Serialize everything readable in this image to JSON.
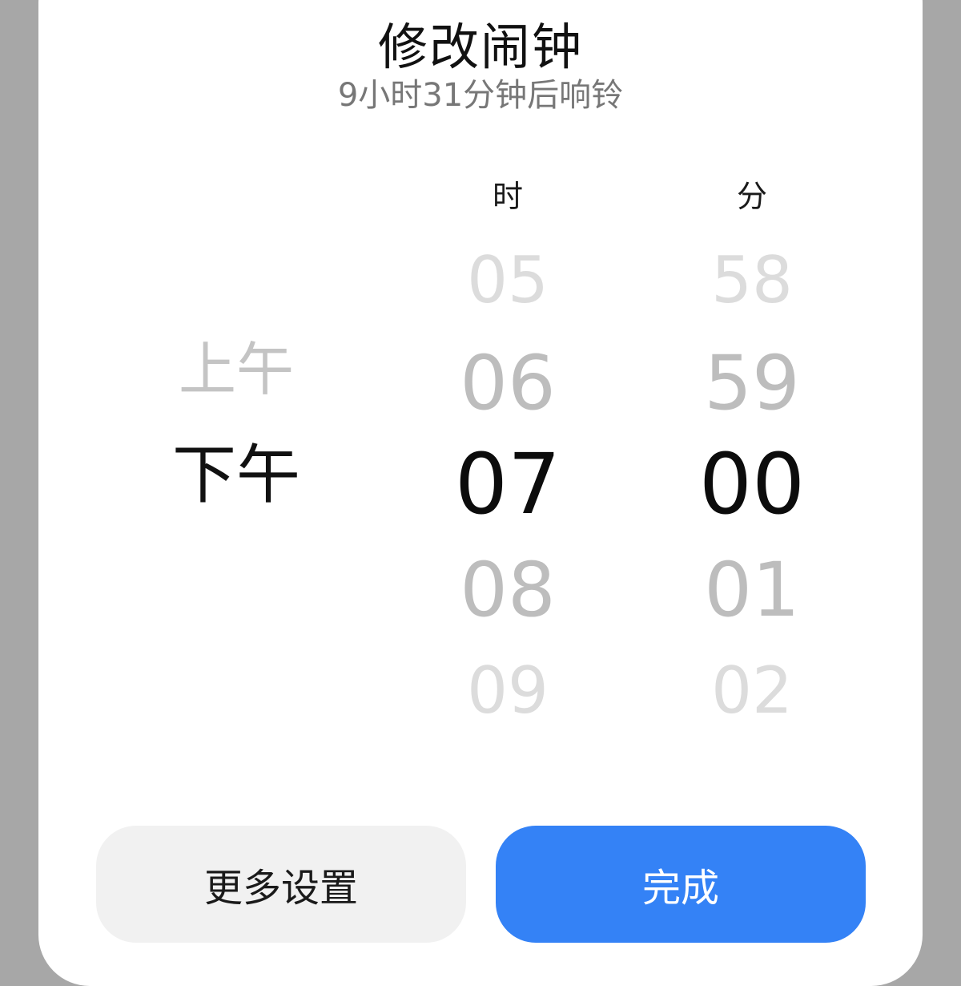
{
  "dialog": {
    "title": "修改闹钟",
    "subtitle": "9小时31分钟后响铃"
  },
  "picker": {
    "hour_label": "时",
    "minute_label": "分",
    "ampm": [
      "上午",
      "下午"
    ],
    "ampm_selected": "下午",
    "hours": [
      "05",
      "06",
      "07",
      "08",
      "09"
    ],
    "hour_selected": "07",
    "minutes": [
      "58",
      "59",
      "00",
      "01",
      "02"
    ],
    "minute_selected": "00"
  },
  "buttons": {
    "more_settings": "更多设置",
    "done": "完成"
  },
  "colors": {
    "accent": "#3482f6",
    "secondary_button": "#f1f1f1",
    "background": "#a7a7a7"
  }
}
